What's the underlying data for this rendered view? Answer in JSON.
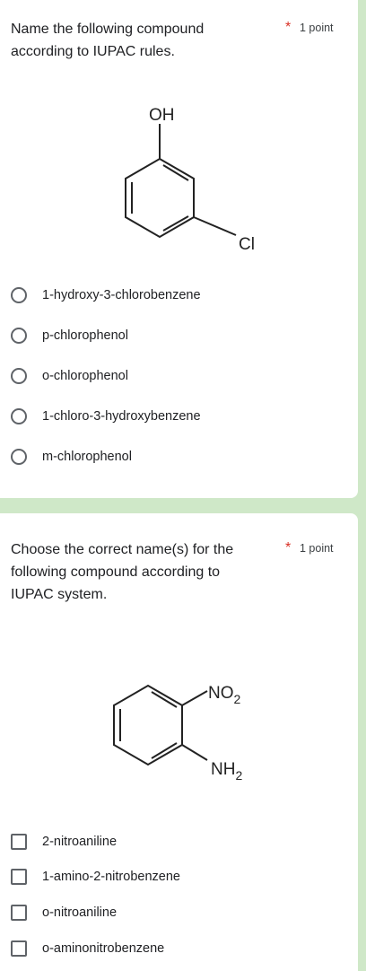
{
  "questions": [
    {
      "text": "Name the following compound\naccording to IUPAC rules.",
      "required_mark": "*",
      "points": "1 point",
      "structure": {
        "top_label": "OH",
        "side_label": "Cl"
      },
      "input_type": "radio",
      "options": [
        "1-hydroxy-3-chlorobenzene",
        "p-chlorophenol",
        "o-chlorophenol",
        "1-chloro-3-hydroxybenzene",
        "m-chlorophenol"
      ]
    },
    {
      "text": "Choose the correct name(s) for the\nfollowing compound according to\nIUPAC system.",
      "required_mark": "*",
      "points": "1 point",
      "structure": {
        "upper_group": "NO",
        "upper_sub": "2",
        "lower_group": "NH",
        "lower_sub": "2"
      },
      "input_type": "checkbox",
      "options": [
        "2-nitroaniline",
        "1-amino-2-nitrobenzene",
        "o-nitroaniline",
        "o-aminonitrobenzene"
      ]
    }
  ],
  "colors": {
    "required": "#d93025",
    "page_background": "#cfe8c8",
    "card": "#ffffff"
  }
}
